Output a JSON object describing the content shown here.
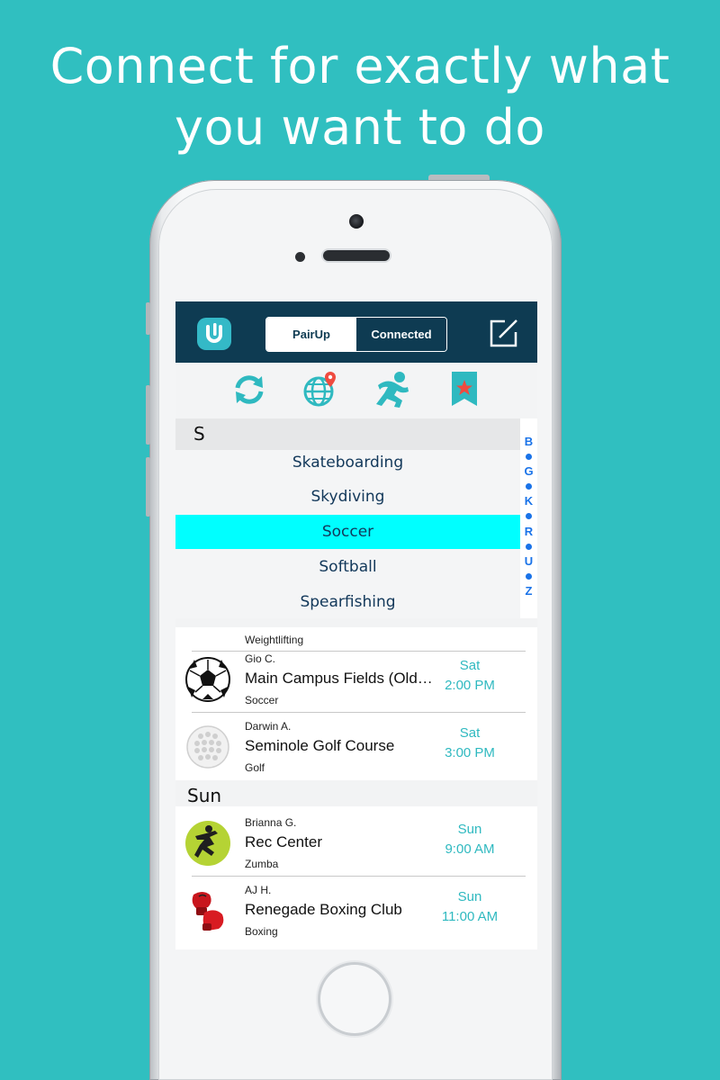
{
  "headline": {
    "line1": "Connect for exactly what",
    "line2": "you want to do"
  },
  "navbar": {
    "tab_pairup": "PairUp",
    "tab_connected": "Connected",
    "selected_tab": "PairUp"
  },
  "filters": {
    "icons": [
      "refresh-icon",
      "globe-location-icon",
      "runner-icon",
      "bookmark-star-icon"
    ]
  },
  "picker": {
    "section": "S",
    "items": [
      "Skateboarding",
      "Skydiving",
      "Soccer",
      "Softball",
      "Spearfishing"
    ],
    "selected": "Soccer",
    "index_letters": [
      "B",
      "G",
      "K",
      "R",
      "U",
      "Z"
    ]
  },
  "list": {
    "partial_row": {
      "activity": "Weightlifting"
    },
    "sat_rows": [
      {
        "name": "Gio C.",
        "location": "Main Campus Fields (Old Practice Fields)",
        "activity": "Soccer",
        "day": "Sat",
        "time": "2:00 PM",
        "icon": "soccer-ball-icon"
      },
      {
        "name": "Darwin A.",
        "location": "Seminole Golf Course",
        "activity": "Golf",
        "day": "Sat",
        "time": "3:00 PM",
        "icon": "golf-ball-icon"
      }
    ],
    "sun_header": "Sun",
    "sun_rows": [
      {
        "name": "Brianna G.",
        "location": "Rec Center",
        "activity": "Zumba",
        "day": "Sun",
        "time": "9:00 AM",
        "icon": "zumba-icon"
      },
      {
        "name": "AJ H.",
        "location": "Renegade Boxing Club",
        "activity": "Boxing",
        "day": "Sun",
        "time": "11:00 AM",
        "icon": "boxing-gloves-icon"
      }
    ]
  },
  "colors": {
    "background": "#30bfc0",
    "navbar": "#0e3b52",
    "accent": "#2fb9c0",
    "selected_row": "#00ffff",
    "index": "#1a73e8"
  }
}
